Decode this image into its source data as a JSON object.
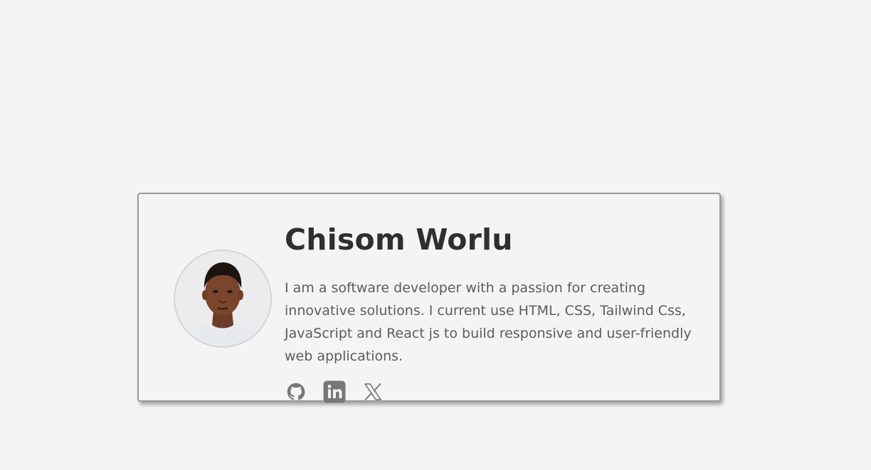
{
  "profile": {
    "name": "Chisom Worlu",
    "bio": "I am a software developer with a passion for creating innovative solutions. I current use HTML, CSS, Tailwind Css, JavaScript and React js to build responsive and user-friendly web applications."
  },
  "socials": [
    {
      "icon": "github-icon",
      "label": "GitHub"
    },
    {
      "icon": "linkedin-icon",
      "label": "LinkedIn"
    },
    {
      "icon": "x-icon",
      "label": "X"
    }
  ],
  "colors": {
    "background": "#f4f4f4",
    "name_text": "#2f2f2f",
    "bio_text": "#5c5c5c",
    "icon": "#777777",
    "card_border": "#9a9a9a"
  }
}
